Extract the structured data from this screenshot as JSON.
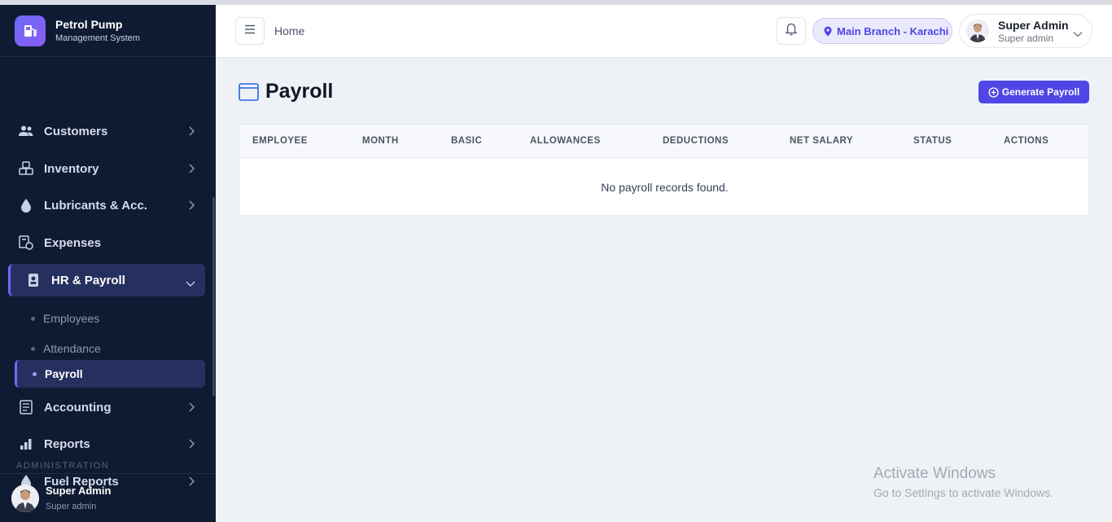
{
  "brand": {
    "title": "Petrol Pump",
    "subtitle": "Management System"
  },
  "sidebar": {
    "items": [
      {
        "label": "Customers",
        "icon": "users-icon"
      },
      {
        "label": "Inventory",
        "icon": "boxes-icon"
      },
      {
        "label": "Lubricants & Acc.",
        "icon": "drop-icon"
      },
      {
        "label": "Expenses",
        "icon": "receipt-icon"
      },
      {
        "label": "HR & Payroll",
        "icon": "id-badge-icon"
      },
      {
        "label": "Accounting",
        "icon": "ledger-icon"
      },
      {
        "label": "Reports",
        "icon": "bar-chart-icon"
      },
      {
        "label": "Fuel Reports",
        "icon": "drop-icon"
      }
    ],
    "hr_sub": [
      {
        "label": "Employees"
      },
      {
        "label": "Attendance"
      },
      {
        "label": "Payroll"
      }
    ],
    "section_label": "ADMINISTRATION",
    "user": {
      "name": "Super Admin",
      "role": "Super admin"
    }
  },
  "header": {
    "breadcrumb": "Home",
    "branch": "Main Branch - Karachi",
    "user": {
      "name": "Super Admin",
      "role": "Super admin"
    }
  },
  "page": {
    "title": "Payroll",
    "generate_button": "Generate Payroll",
    "table": {
      "columns": [
        "EMPLOYEE",
        "MONTH",
        "BASIC",
        "ALLOWANCES",
        "DEDUCTIONS",
        "NET SALARY",
        "STATUS",
        "ACTIONS"
      ],
      "empty_message": "No payroll records found."
    }
  },
  "watermark": {
    "line1": "Activate Windows",
    "line2": "Go to Settings to activate Windows."
  },
  "colors": {
    "sidebar_bg": "#0f1b33",
    "accent": "#4f46e5",
    "active_bg": "#26305e"
  }
}
